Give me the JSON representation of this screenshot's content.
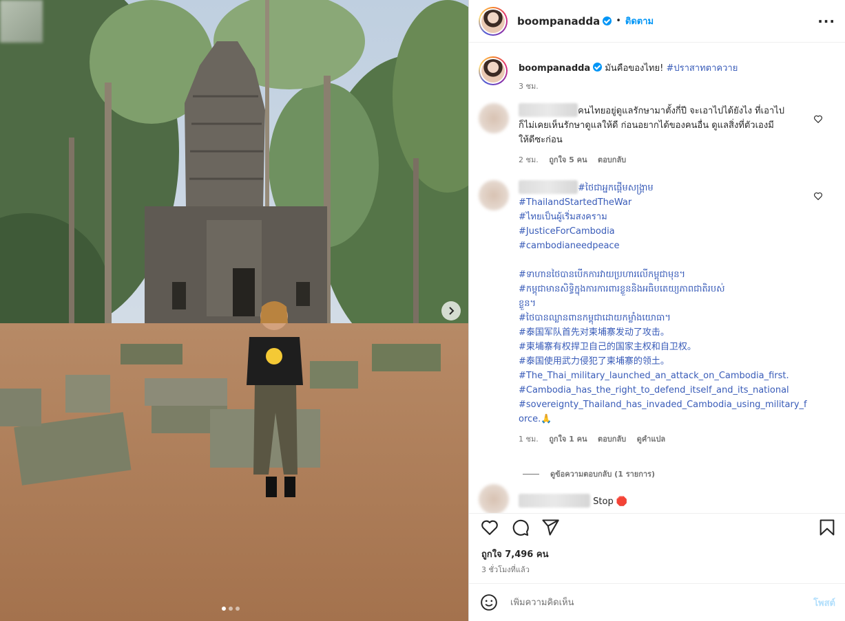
{
  "header": {
    "username": "boompanadda",
    "separator": "•",
    "follow_label": "ติดตาม",
    "more_label": "···"
  },
  "caption": {
    "username": "boompanadda",
    "text": "มันคือของไทย!",
    "hashtag": "#ปราสาทตาควาย",
    "time": "3 ชม."
  },
  "comments": [
    {
      "text_lines": [
        "คนไทยอยู่ดูแลรักษามาตั้งกี่ปี จะเอาไปได้ยังไง ที่เอาไป",
        "ก็ไม่เคยเห็นรักษาดูแลให้ดี ก่อนอยากได้ของคนอื่น ดูแลสิ่งที่ตัวเองมี",
        "ให้ดีซะก่อน"
      ],
      "time": "2 ชม.",
      "likes": "ถูกใจ 5 คน",
      "reply": "ตอบกลับ"
    },
    {
      "first_line": "#ថៃជាអ្នកផ្តើមសង្គ្រាម",
      "hashtag_lines": [
        "#ThailandStartedTheWar",
        "#ไทยเป็นผู้เริ่มสงคราม",
        "#JusticeForCambodia",
        "#cambodianeedpeace",
        "",
        "#ទាហានថៃបានបើកការវាយប្រហារលើកម្ពុជាមុន។",
        "#កម្ពុជាមានសិទ្ធិក្នុងការការពារខ្លួននិងអធិបតេយ្យភាពជាតិរបស់",
        "ខ្លួន។",
        "#ថៃបានឈ្លានពានកម្ពុជាដោយកម្លាំងយោធា។",
        "#泰国军队首先对柬埔寨发动了攻击。",
        "#柬埔寨有权捍卫自己的国家主权和自卫权。",
        "#泰国使用武力侵犯了柬埔寨的领土。",
        "#The_Thai_military_launched_an_attack_on_Cambodia_first.",
        "#Cambodia_has_the_right_to_defend_itself_and_its_national",
        "#sovereignty_Thailand_has_invaded_Cambodia_using_military_f",
        "orce.🙏"
      ],
      "time": "1 ชม.",
      "likes": "ถูกใจ 1 คน",
      "reply": "ตอบกลับ",
      "translate": "ดูคำแปล"
    }
  ],
  "view_replies": "ดูข้อความตอบกลับ (1 รายการ)",
  "partial_comment": {
    "text": "Stop 🛑"
  },
  "actions": {
    "like_icon": "heart-icon",
    "comment_icon": "comment-icon",
    "share_icon": "send-icon",
    "save_icon": "bookmark-icon"
  },
  "likes_count": "ถูกใจ 7,496 คน",
  "posted_time": "3 ชั่วโมงที่แล้ว",
  "add_comment": {
    "placeholder": "เพิ่มความคิดเห็น",
    "post_label": "โพสต์"
  },
  "carousel": {
    "current": 1,
    "total": 3
  }
}
